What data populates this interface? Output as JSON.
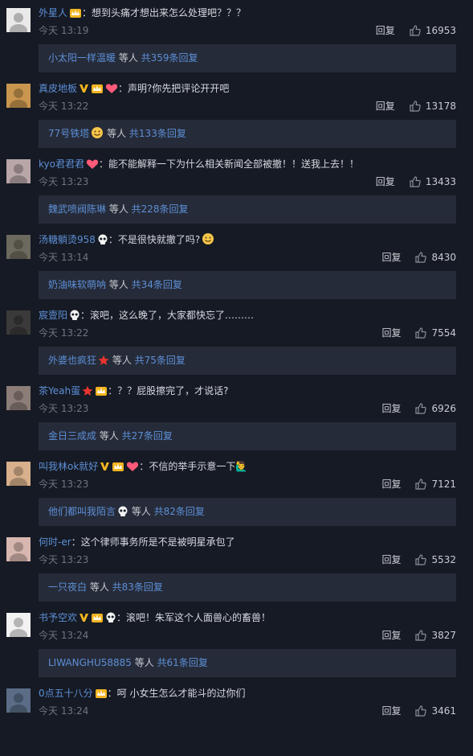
{
  "comments": [
    {
      "name": "外星人",
      "badges": [
        "crown-icon"
      ],
      "text": "想到头痛才想出来怎么处理吧？？？",
      "time": "今天 13:19",
      "reply": "回复",
      "likes": "16953",
      "replies": {
        "user": "小太阳一样温暖",
        "user_icon": "",
        "mid": " 等人 ",
        "count": "共359条回复"
      },
      "avatar_color": "#e9e9e9"
    },
    {
      "name": "真皮地板",
      "badges": [
        "v-icon",
        "crown-icon",
        "heart-icon"
      ],
      "text": "声明?你先把评论开开吧",
      "time": "今天 13:22",
      "reply": "回复",
      "likes": "13178",
      "replies": {
        "user": "77号铁塔",
        "user_icon": "smile-icon",
        "mid": " 等人 ",
        "count": "共133条回复"
      },
      "avatar_color": "#c9964f"
    },
    {
      "name": "kyo君君君",
      "badges": [
        "heart-icon"
      ],
      "text": "能不能解释一下为什么相关新闻全部被撤！！送我上去！！",
      "time": "今天 13:23",
      "reply": "回复",
      "likes": "13433",
      "replies": {
        "user": "魏武喷阀陈琳",
        "user_icon": "",
        "mid": " 等人 ",
        "count": "共228条回复"
      },
      "avatar_color": "#b8a6a8"
    },
    {
      "name": "汤糖躺烫958",
      "badges": [
        "skull-icon"
      ],
      "text": "不是很快就撤了吗?",
      "text_suffix_icon": "smile-icon",
      "time": "今天 13:14",
      "reply": "回复",
      "likes": "8430",
      "replies": {
        "user": "奶油味软萌呐",
        "user_icon": "",
        "mid": " 等人 ",
        "count": "共34条回复"
      },
      "avatar_color": "#6c6a5e"
    },
    {
      "name": "宸壹阳",
      "badges": [
        "skull-icon"
      ],
      "text": "滚吧，这么晚了，大家都快忘了………",
      "time": "今天 13:22",
      "reply": "回复",
      "likes": "7554",
      "replies": {
        "user": "外婆也疯狂",
        "user_icon": "star-icon",
        "mid": " 等人 ",
        "count": "共75条回复"
      },
      "avatar_color": "#3a3a3a"
    },
    {
      "name": "茶Yeah蛋",
      "badges": [
        "star-icon",
        "crown-icon"
      ],
      "text": "？？屁股擦完了，才说话?",
      "time": "今天 13:23",
      "reply": "回复",
      "likes": "6926",
      "replies": {
        "user": "金日三成成",
        "user_icon": "",
        "mid": " 等人 ",
        "count": "共27条回复"
      },
      "avatar_color": "#8c7d78"
    },
    {
      "name": "叫我林ok就好",
      "badges": [
        "v-icon",
        "crown-icon",
        "heart-icon"
      ],
      "text": "不信的举手示意一下🙋‍♂",
      "time": "今天 13:23",
      "reply": "回复",
      "likes": "7121",
      "replies": {
        "user": "他们都叫我陌言",
        "user_icon": "skull-icon",
        "mid": " 等人 ",
        "count": "共82条回复"
      },
      "avatar_color": "#d9b08c"
    },
    {
      "name": "何时-er",
      "badges": [],
      "text": "这个律师事务所是不是被明星承包了",
      "time": "今天 13:23",
      "reply": "回复",
      "likes": "5532",
      "replies": {
        "user": "一只夜白",
        "user_icon": "",
        "mid": " 等人 ",
        "count": "共83条回复"
      },
      "avatar_color": "#d8b7b0"
    },
    {
      "name": "书予空欢",
      "badges": [
        "v-icon",
        "crown-icon",
        "skull-icon"
      ],
      "text": "滚吧！朱军这个人面兽心的畜兽！",
      "time": "今天 13:24",
      "reply": "回复",
      "likes": "3827",
      "replies": {
        "user": "LIWANGHU58885",
        "user_icon": "",
        "mid": " 等人 ",
        "count": "共61条回复"
      },
      "avatar_color": "#f2f2f2"
    },
    {
      "name": "0点五十八分",
      "badges": [
        "crown-icon"
      ],
      "text": "呵 小女生怎么才能斗的过你们",
      "time": "今天 13:24",
      "reply": "回复",
      "likes": "3461",
      "replies": null,
      "avatar_color": "#5a6c86"
    }
  ],
  "colors": {
    "background": "#161a24",
    "reply_box": "#262b39",
    "name": "#5c8fd6",
    "time": "#6e7480"
  }
}
